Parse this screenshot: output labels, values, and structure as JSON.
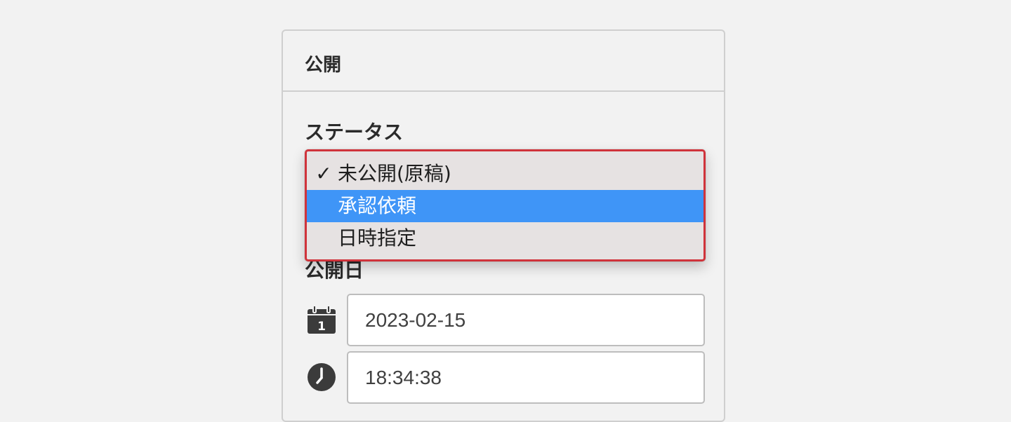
{
  "panel": {
    "title": "公開"
  },
  "status": {
    "label": "ステータス",
    "dropdown": {
      "options": [
        {
          "label": "未公開(原稿)",
          "checked": true,
          "highlighted": false
        },
        {
          "label": "承認依頼",
          "checked": false,
          "highlighted": true
        },
        {
          "label": "日時指定",
          "checked": false,
          "highlighted": false
        }
      ],
      "check_glyph": "✓",
      "highlight_color": "#3f95f7",
      "border_color": "#d0333b"
    }
  },
  "publish_date": {
    "label": "公開日",
    "date_value": "2023-02-15",
    "time_value": "18:34:38",
    "date_icon": "calendar-icon",
    "time_icon": "clock-icon"
  }
}
